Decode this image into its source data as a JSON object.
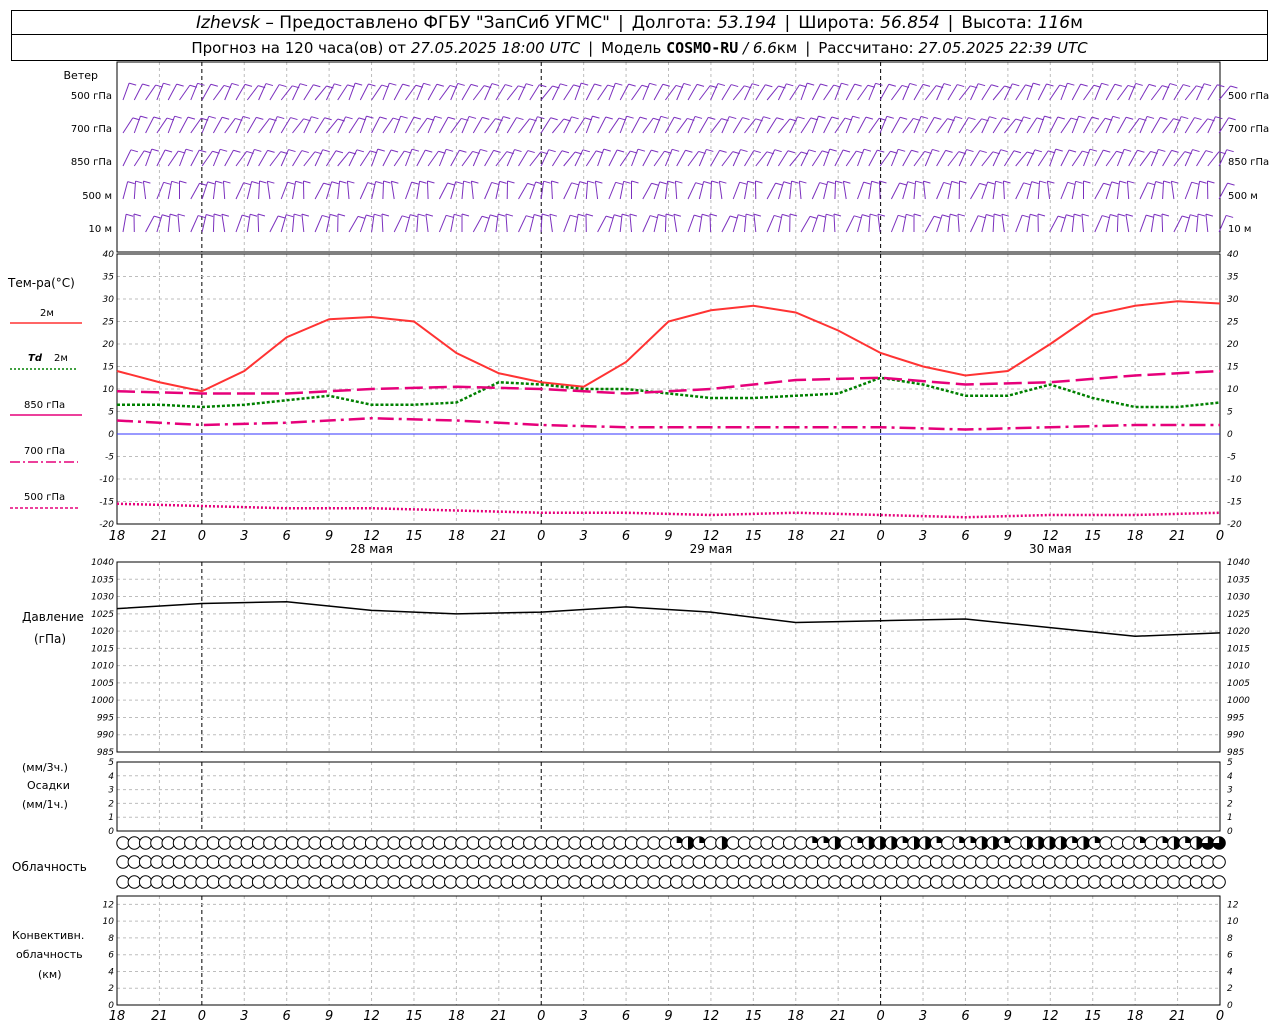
{
  "header": {
    "city": "Izhevsk",
    "provider": "– Предоставлено ФГБУ \"ЗапСиб УГМС\"",
    "lon_label": "Долгота:",
    "lon_value": "53.194",
    "lat_label": "Широта:",
    "lat_value": "56.854",
    "alt_label": "Высота:",
    "alt_value": "116",
    "alt_unit": "м",
    "forecast_label": "Прогноз на 120 часа(ов) от",
    "forecast_time": "27.05.2025 18:00 UTC",
    "model_label": "Модель",
    "model_name": "COSMO-RU",
    "model_res": "/ 6.6",
    "model_res_unit": "км",
    "computed_label": "Рассчитано:",
    "computed_time": "27.05.2025 22:39 UTC"
  },
  "panel_labels": {
    "wind_title": "Ветер",
    "wind_levels": [
      "500 гПа",
      "700 гПа",
      "850 гПа",
      "500 м",
      "10 м"
    ],
    "temp_title": "Тем-ра(°C)",
    "legend_2m": "2м",
    "legend_td": "Td",
    "legend_td_2m": "2м",
    "legend_850": "850 гПа",
    "legend_700": "700 гПа",
    "legend_500": "500 гПа",
    "pressure_title": "Давление",
    "pressure_unit": "(гПа)",
    "precip_unit_3h": "(мм/3ч.)",
    "precip_title": "Осадки",
    "precip_unit_1h": "(мм/1ч.)",
    "cloud_title": "Облачность",
    "conv_title_1": "Конвективн.",
    "conv_title_2": "облачность",
    "conv_unit": "(км)"
  },
  "chart_data": {
    "type": "line",
    "time_axis": {
      "hour_labels": [
        "18",
        "21",
        "0",
        "3",
        "6",
        "9",
        "12",
        "15",
        "18",
        "21",
        "0",
        "3",
        "6",
        "9",
        "12",
        "15",
        "18",
        "21",
        "0",
        "3",
        "6",
        "9",
        "12",
        "15",
        "18",
        "21",
        "0"
      ],
      "day_labels": [
        {
          "text": "28 мая",
          "hour": 18
        },
        {
          "text": "29 мая",
          "hour": 42
        },
        {
          "text": "30 мая",
          "hour": 66
        }
      ],
      "range_hours": [
        0,
        78
      ]
    },
    "temperature": {
      "ylim": [
        -20,
        40
      ],
      "yticks": [
        40,
        35,
        30,
        25,
        20,
        15,
        10,
        5,
        0,
        -5,
        -10,
        -15,
        -20
      ],
      "series": [
        {
          "name": "2м",
          "color": "#ff3333",
          "style": "solid",
          "points": [
            [
              0,
              14
            ],
            [
              3,
              11.5
            ],
            [
              6,
              9.5
            ],
            [
              9,
              14
            ],
            [
              12,
              21.5
            ],
            [
              15,
              25.5
            ],
            [
              18,
              26
            ],
            [
              21,
              25
            ],
            [
              24,
              18
            ],
            [
              27,
              13.5
            ],
            [
              30,
              11.5
            ],
            [
              33,
              10.5
            ],
            [
              36,
              16
            ],
            [
              39,
              25
            ],
            [
              42,
              27.5
            ],
            [
              45,
              28.5
            ],
            [
              48,
              27
            ],
            [
              51,
              23
            ],
            [
              54,
              18
            ],
            [
              57,
              15
            ],
            [
              60,
              13
            ],
            [
              63,
              14
            ],
            [
              66,
              20
            ],
            [
              69,
              26.5
            ],
            [
              72,
              28.5
            ],
            [
              75,
              29.5
            ],
            [
              78,
              29
            ]
          ]
        },
        {
          "name": "Td 2м",
          "color": "#008000",
          "style": "dotted",
          "points": [
            [
              0,
              6.5
            ],
            [
              3,
              6.5
            ],
            [
              6,
              6
            ],
            [
              9,
              6.5
            ],
            [
              12,
              7.5
            ],
            [
              15,
              8.5
            ],
            [
              18,
              6.5
            ],
            [
              21,
              6.5
            ],
            [
              24,
              7
            ],
            [
              27,
              11.5
            ],
            [
              30,
              11
            ],
            [
              33,
              10
            ],
            [
              36,
              10
            ],
            [
              39,
              9
            ],
            [
              42,
              8
            ],
            [
              45,
              8
            ],
            [
              48,
              8.5
            ],
            [
              51,
              9
            ],
            [
              54,
              12.5
            ],
            [
              57,
              11
            ],
            [
              60,
              8.5
            ],
            [
              63,
              8.5
            ],
            [
              66,
              11
            ],
            [
              69,
              8
            ],
            [
              72,
              6
            ],
            [
              75,
              6
            ],
            [
              78,
              7
            ]
          ]
        },
        {
          "name": "850 гПа",
          "color": "#e6007a",
          "style": "dashed",
          "points": [
            [
              0,
              9.5
            ],
            [
              6,
              9
            ],
            [
              12,
              9
            ],
            [
              18,
              10
            ],
            [
              24,
              10.5
            ],
            [
              30,
              10
            ],
            [
              36,
              9
            ],
            [
              42,
              10
            ],
            [
              48,
              12
            ],
            [
              54,
              12.5
            ],
            [
              60,
              11
            ],
            [
              66,
              11.5
            ],
            [
              72,
              13
            ],
            [
              78,
              14
            ]
          ]
        },
        {
          "name": "700 гПа",
          "color": "#e6007a",
          "style": "dashdot",
          "points": [
            [
              0,
              3
            ],
            [
              6,
              2
            ],
            [
              12,
              2.5
            ],
            [
              18,
              3.5
            ],
            [
              24,
              3
            ],
            [
              30,
              2
            ],
            [
              36,
              1.5
            ],
            [
              42,
              1.5
            ],
            [
              48,
              1.5
            ],
            [
              54,
              1.5
            ],
            [
              60,
              1
            ],
            [
              66,
              1.5
            ],
            [
              72,
              2
            ],
            [
              78,
              2
            ]
          ]
        },
        {
          "name": "500 гПа",
          "color": "#e6007a",
          "style": "dots",
          "points": [
            [
              0,
              -15.5
            ],
            [
              6,
              -16
            ],
            [
              12,
              -16.5
            ],
            [
              18,
              -16.5
            ],
            [
              24,
              -17
            ],
            [
              30,
              -17.5
            ],
            [
              36,
              -17.5
            ],
            [
              42,
              -18
            ],
            [
              48,
              -17.5
            ],
            [
              54,
              -18
            ],
            [
              60,
              -18.5
            ],
            [
              66,
              -18
            ],
            [
              72,
              -18
            ],
            [
              78,
              -17.5
            ]
          ]
        }
      ]
    },
    "pressure": {
      "ylim": [
        985,
        1040
      ],
      "yticks": [
        1040,
        1035,
        1030,
        1025,
        1020,
        1015,
        1010,
        1005,
        1000,
        995,
        990,
        985
      ],
      "series": [
        {
          "name": "Давление",
          "color": "#000000",
          "points": [
            [
              0,
              1026.5
            ],
            [
              6,
              1028
            ],
            [
              12,
              1028.5
            ],
            [
              18,
              1026
            ],
            [
              24,
              1025
            ],
            [
              30,
              1025.5
            ],
            [
              36,
              1027
            ],
            [
              42,
              1025.5
            ],
            [
              48,
              1022.5
            ],
            [
              54,
              1023
            ],
            [
              60,
              1023.5
            ],
            [
              66,
              1021
            ],
            [
              72,
              1018.5
            ],
            [
              78,
              1019.5
            ]
          ]
        }
      ]
    },
    "precip": {
      "ylim": [
        0,
        5
      ],
      "yticks": [
        5,
        4,
        3,
        2,
        1,
        0
      ],
      "values": []
    },
    "convective": {
      "ylim": [
        0,
        13
      ],
      "yticks": [
        12,
        10,
        8,
        6,
        4,
        2,
        0
      ],
      "values": []
    },
    "cloud_cover": {
      "rows": 3,
      "cover": [
        [
          0,
          0,
          0,
          0,
          0,
          0,
          0,
          0,
          0,
          0,
          0,
          0,
          0,
          0,
          0,
          0,
          0,
          0,
          0,
          0,
          0,
          0,
          0,
          0,
          0,
          0,
          0,
          0,
          0,
          0,
          0,
          0,
          0,
          0,
          0,
          0,
          0,
          0,
          0,
          0,
          0,
          0,
          0,
          0,
          0,
          0,
          0,
          0,
          0,
          0,
          0,
          0,
          0,
          0,
          0,
          0,
          0,
          0,
          0,
          0,
          0,
          0,
          0,
          0,
          0,
          0,
          0,
          0,
          0,
          0,
          0,
          0,
          0,
          0,
          0,
          0,
          0,
          0,
          0,
          0,
          0,
          0,
          0,
          0,
          0,
          0,
          0,
          0,
          0,
          0,
          0,
          0,
          0,
          0,
          0,
          0,
          0,
          0
        ],
        [
          0,
          0,
          0,
          0,
          0,
          0,
          0,
          0,
          0,
          0,
          0,
          0,
          0,
          0,
          0,
          0,
          0,
          0,
          0,
          0,
          0,
          0,
          0,
          0,
          0,
          0,
          0,
          0,
          0,
          0,
          0,
          0,
          0,
          0,
          0,
          0,
          0,
          0,
          0,
          0,
          0,
          0,
          0,
          0,
          0,
          0,
          0,
          0,
          0,
          0,
          0,
          0,
          0,
          0,
          0,
          0,
          0,
          0,
          0,
          0,
          0,
          0,
          0,
          0,
          0,
          0,
          0,
          0,
          0,
          0,
          0,
          0,
          0,
          0,
          0,
          0,
          0,
          0,
          0,
          0,
          0,
          0,
          0,
          0,
          0,
          0,
          0,
          0,
          0,
          0,
          0,
          0,
          0,
          0,
          0,
          0,
          0,
          0
        ],
        [
          0,
          0,
          0,
          0,
          0,
          0,
          0,
          0,
          0,
          0,
          0,
          0,
          0,
          0,
          0,
          0,
          0,
          0,
          0,
          0,
          0,
          0,
          0,
          0,
          0,
          0,
          0,
          0,
          0,
          0,
          0,
          0,
          0,
          0,
          0,
          0,
          0,
          0,
          0,
          0,
          0,
          0,
          0,
          0,
          0,
          0,
          0,
          0,
          0,
          0,
          0,
          0,
          0,
          0,
          0,
          0,
          0,
          0,
          0,
          0,
          0,
          0,
          0,
          0,
          0,
          0,
          0,
          0,
          0,
          0,
          0,
          0,
          0,
          0,
          0,
          0,
          0,
          0,
          0,
          0,
          0,
          0,
          0,
          0,
          0,
          0,
          0,
          0,
          0,
          0,
          0,
          0,
          0,
          0,
          0,
          0,
          0,
          0
        ]
      ],
      "top_row_cover": [
        0,
        0,
        0,
        0,
        0,
        0,
        0,
        0,
        0,
        0,
        0,
        0,
        0,
        0,
        0,
        0,
        0,
        0,
        0,
        0,
        0,
        0,
        0,
        0,
        0,
        0,
        0,
        0,
        0,
        0,
        0,
        0,
        0,
        0,
        0,
        0,
        0,
        0,
        0,
        0,
        0,
        0,
        0,
        0,
        0,
        0,
        0,
        0,
        0,
        0.25,
        0.5,
        0.25,
        0,
        0.5,
        0,
        0,
        0,
        0,
        0,
        0,
        0,
        0.25,
        0.25,
        0.5,
        0,
        0.25,
        0.5,
        0.5,
        0.5,
        0.25,
        0.5,
        0.5,
        0.25,
        0,
        0.25,
        0.25,
        0.5,
        0.5,
        0.25,
        0,
        0.5,
        0.5,
        0.5,
        0.5,
        0.25,
        0.5,
        0.25,
        0,
        0,
        0,
        0.25,
        0,
        0.25,
        0.5,
        0.25,
        0.5,
        0.75,
        0.75
      ]
    },
    "wind": {
      "color": "#7b2fbe",
      "levels": [
        "500 гПа",
        "700 гПа",
        "850 гПа",
        "500 м",
        "10 м"
      ]
    }
  }
}
